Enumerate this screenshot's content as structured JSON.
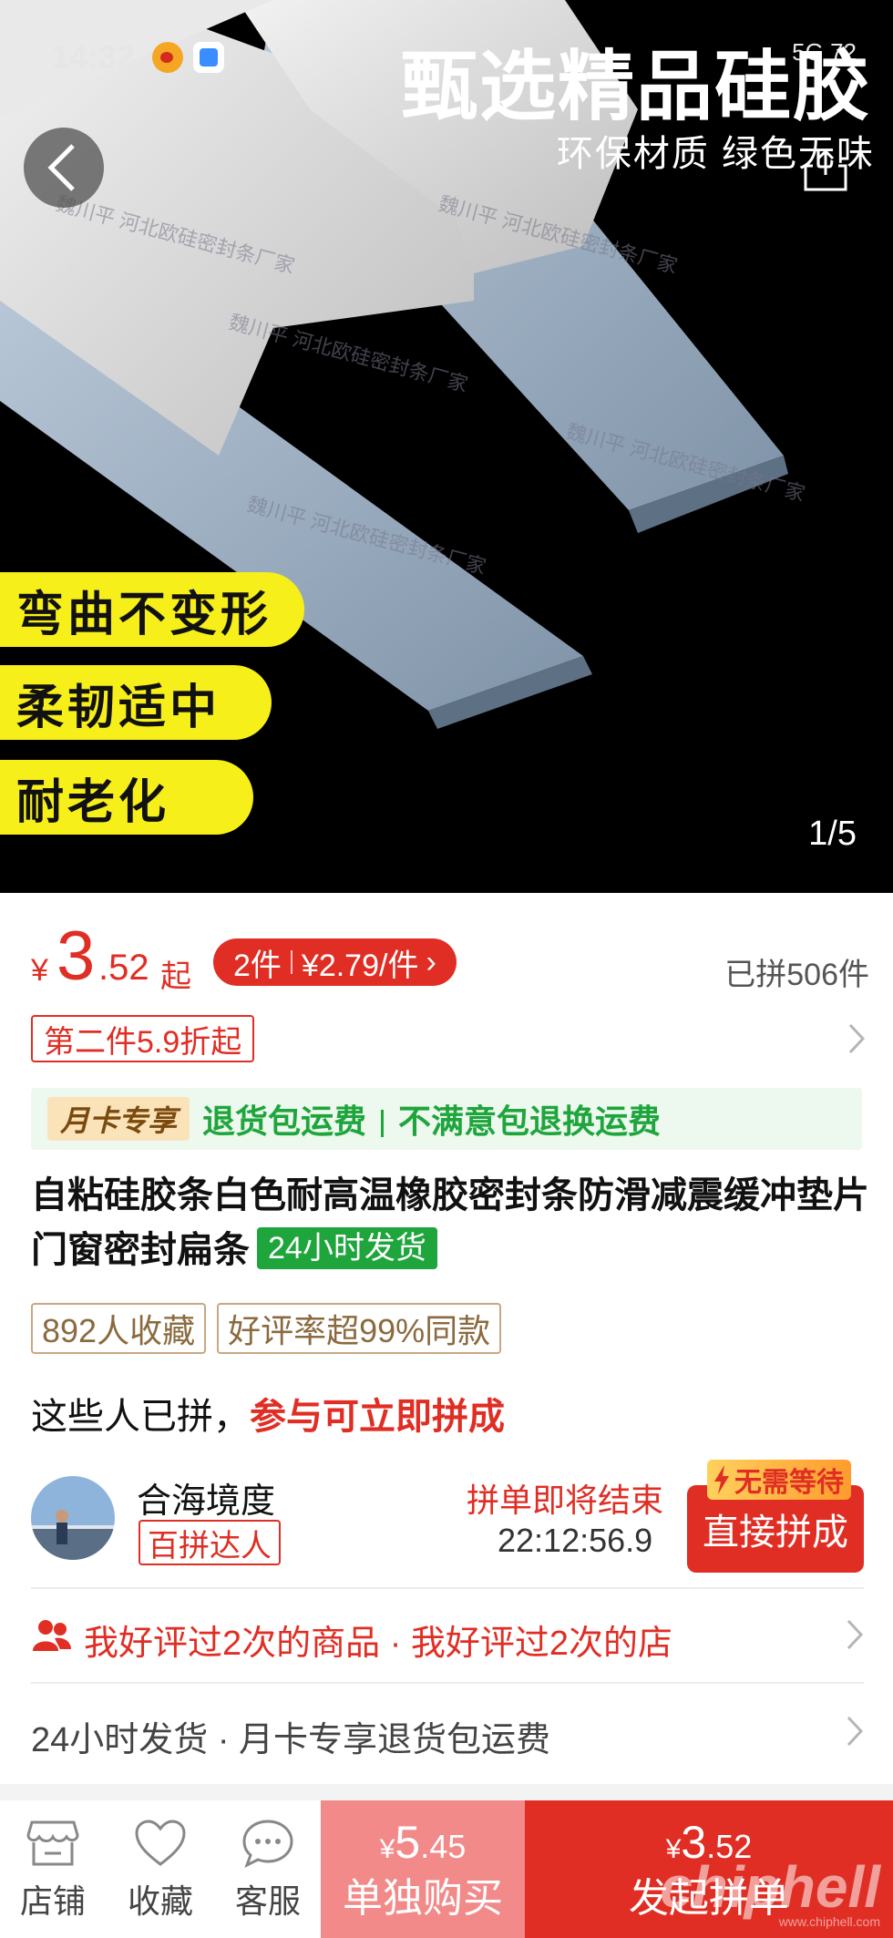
{
  "status": {
    "time": "14:32",
    "right": "5G 72"
  },
  "hero": {
    "title": "甄选精品硅胶",
    "subtitle": "环保材质 绿色无味",
    "pills": [
      "弯曲不变形",
      "柔韧适中",
      "耐老化"
    ],
    "page_indicator": "1/5",
    "watermark": "魏川平 河北欧硅密封条厂家"
  },
  "price": {
    "currency": "¥",
    "integer": "3",
    "decimal": ".52",
    "suffix": "起",
    "multi_qty": "2件",
    "multi_price": "¥2.79/件",
    "sold": "已拼506件"
  },
  "discount": {
    "label": "第二件5.9折起"
  },
  "month_card": {
    "tag": "月卡专享",
    "text1": "退货包运费",
    "text2": "不满意包退换运费"
  },
  "product": {
    "title": "自粘硅胶条白色耐高温橡胶密封条防滑减震缓冲垫片门窗密封扁条",
    "ship_badge": "24小时发货"
  },
  "tags": [
    "892人收藏",
    "好评率超99%同款"
  ],
  "group": {
    "heading_plain": "这些人已拼，",
    "heading_highlight": "参与可立即拼成",
    "user_name": "合海境度",
    "user_role": "百拼达人",
    "ending": "拼单即将结束",
    "timer": "22:12:56.9",
    "no_wait": "无需等待",
    "join_label": "直接拼成"
  },
  "review": {
    "text": "我好评过2次的商品 · 我好评过2次的店"
  },
  "shipping": {
    "text": "24小时发货 · 月卡专享退货包运费"
  },
  "bottom": {
    "shop": "店铺",
    "favorite": "收藏",
    "service": "客服",
    "single_currency": "¥",
    "single_int": "5",
    "single_dec": ".45",
    "single_label": "单独购买",
    "group_currency": "¥",
    "group_int": "3",
    "group_dec": ".52",
    "group_label": "发起拼单",
    "watermark": "chiphell",
    "watermark_url": "www.chiphell.com"
  },
  "colors": {
    "accent": "#e02e24",
    "green": "#1ea53c",
    "pill_yellow": "#f7ef1a"
  }
}
